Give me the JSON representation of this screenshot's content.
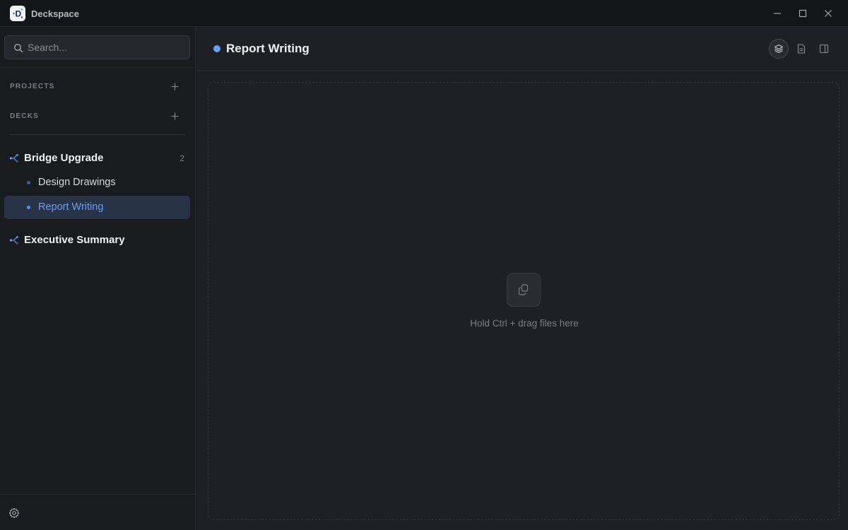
{
  "app": {
    "title": "Deckspace",
    "accent_color": "#6aa0f0"
  },
  "window_controls": {
    "icons": [
      "minimize-icon",
      "maximize-icon",
      "close-icon"
    ]
  },
  "sidebar": {
    "search": {
      "placeholder": "Search...",
      "value": ""
    },
    "sections": [
      {
        "label": "PROJECTS"
      },
      {
        "label": "DECKS"
      }
    ],
    "projects": [
      {
        "label": "Bridge Upgrade",
        "count": "2",
        "decks": [
          {
            "label": "Design Drawings",
            "active": false
          },
          {
            "label": "Report Writing",
            "active": true
          }
        ]
      },
      {
        "label": "Executive Summary",
        "count": "",
        "decks": []
      }
    ]
  },
  "main": {
    "title": "Report Writing",
    "toolbar_icons": [
      "layers-icon",
      "document-icon",
      "panel-icon"
    ],
    "dropzone": {
      "hint": "Hold Ctrl + drag files here"
    }
  }
}
